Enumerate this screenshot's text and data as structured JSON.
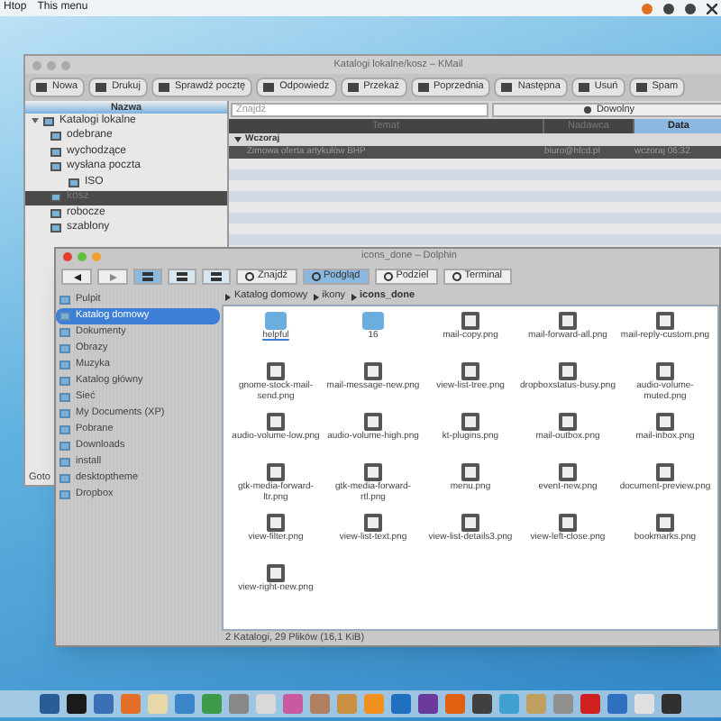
{
  "top_panel": {
    "items": [
      "Htop",
      "This menu"
    ]
  },
  "kmail": {
    "title": "Katalogi lokalne/kosz – KMail",
    "toolbar": [
      "Nowa",
      "Drukuj",
      "Sprawdź pocztę",
      "Odpowiedz",
      "Przekaż",
      "Poprzednia",
      "Następna",
      "Usuń",
      "Spam"
    ],
    "folder_header": "Nazwa",
    "folders": [
      {
        "label": "Katalogi lokalne",
        "expanded": true,
        "selected": false,
        "children": [
          {
            "label": "odebrane",
            "selected": false
          },
          {
            "label": "wychodzące",
            "selected": false
          },
          {
            "label": "wysłana poczta",
            "selected": false,
            "children": [
              {
                "label": "ISO",
                "selected": false
              }
            ]
          },
          {
            "label": "kosz",
            "selected": true
          },
          {
            "label": "robocze",
            "selected": false
          },
          {
            "label": "szablony",
            "selected": false
          }
        ]
      }
    ],
    "search": {
      "placeholder": "Znajdź"
    },
    "filter": "Dowolny",
    "columns": [
      {
        "label": "Temat",
        "selected": false
      },
      {
        "label": "Nadawca",
        "selected": false
      },
      {
        "label": "Data",
        "selected": true
      }
    ],
    "group": "Wczoraj",
    "messages": [
      {
        "subject": "Zimowa oferta artykułów BHP",
        "sender": "biuro@hfcd.pl",
        "date": "wczoraj 06:32"
      }
    ],
    "status": "Goto"
  },
  "dolphin": {
    "title": "icons_done – Dolphin",
    "toolbar": [
      {
        "label": "Znajdź",
        "selected": false
      },
      {
        "label": "Podgląd",
        "selected": true
      },
      {
        "label": "Podziel",
        "selected": false
      },
      {
        "label": "Terminal",
        "selected": false
      }
    ],
    "views": [
      {
        "selected": true
      },
      {
        "selected": false
      },
      {
        "selected": false
      }
    ],
    "places": [
      {
        "label": "Pulpit",
        "selected": false
      },
      {
        "label": "Katalog domowy",
        "selected": true
      },
      {
        "label": "Dokumenty",
        "selected": false
      },
      {
        "label": "Obrazy",
        "selected": false
      },
      {
        "label": "Muzyka",
        "selected": false
      },
      {
        "label": "Katalog główny",
        "selected": false
      },
      {
        "label": "Sieć",
        "selected": false
      },
      {
        "label": "My Documents (XP)",
        "selected": false
      },
      {
        "label": "Pobrane",
        "selected": false
      },
      {
        "label": "Downloads",
        "selected": false
      },
      {
        "label": "install",
        "selected": false
      },
      {
        "label": "desktoptheme",
        "selected": false
      },
      {
        "label": "Dropbox",
        "selected": false
      }
    ],
    "breadcrumb": [
      "Katalog domowy",
      "ikony",
      "icons_done"
    ],
    "files": [
      {
        "name": "helpful",
        "kind": "folder",
        "selected": true
      },
      {
        "name": "16",
        "kind": "folder",
        "selected": false
      },
      {
        "name": "mail-copy.png",
        "kind": "file",
        "selected": false
      },
      {
        "name": "mail-forward-all.png",
        "kind": "file",
        "selected": false
      },
      {
        "name": "mail-reply-custom.png",
        "kind": "file",
        "selected": false
      },
      {
        "name": "gnome-stock-mail-send.png",
        "kind": "file",
        "selected": false
      },
      {
        "name": "mail-message-new.png",
        "kind": "file",
        "selected": false
      },
      {
        "name": "view-list-tree.png",
        "kind": "file",
        "selected": false
      },
      {
        "name": "dropboxstatus-busy.png",
        "kind": "file",
        "selected": false
      },
      {
        "name": "audio-volume-muted.png",
        "kind": "file",
        "selected": false
      },
      {
        "name": "audio-volume-low.png",
        "kind": "file",
        "selected": false
      },
      {
        "name": "audio-volume-high.png",
        "kind": "file",
        "selected": false
      },
      {
        "name": "kt-plugins.png",
        "kind": "file",
        "selected": false
      },
      {
        "name": "mail-outbox.png",
        "kind": "file",
        "selected": false
      },
      {
        "name": "mail-inbox.png",
        "kind": "file",
        "selected": false
      },
      {
        "name": "gtk-media-forward-ltr.png",
        "kind": "file",
        "selected": false
      },
      {
        "name": "gtk-media-forward-rtl.png",
        "kind": "file",
        "selected": false
      },
      {
        "name": "menu.png",
        "kind": "file",
        "selected": false
      },
      {
        "name": "event-new.png",
        "kind": "file",
        "selected": false
      },
      {
        "name": "document-preview.png",
        "kind": "file",
        "selected": false
      },
      {
        "name": "view-filter.png",
        "kind": "file",
        "selected": false
      },
      {
        "name": "view-list-text.png",
        "kind": "file",
        "selected": false
      },
      {
        "name": "view-list-details3.png",
        "kind": "file",
        "selected": false
      },
      {
        "name": "view-left-close.png",
        "kind": "file",
        "selected": false
      },
      {
        "name": "bookmarks.png",
        "kind": "file",
        "selected": false
      },
      {
        "name": "view-right-new.png",
        "kind": "file",
        "selected": false
      }
    ],
    "status": "2 Katalogi, 29 Plików (16,1 KiB)"
  }
}
